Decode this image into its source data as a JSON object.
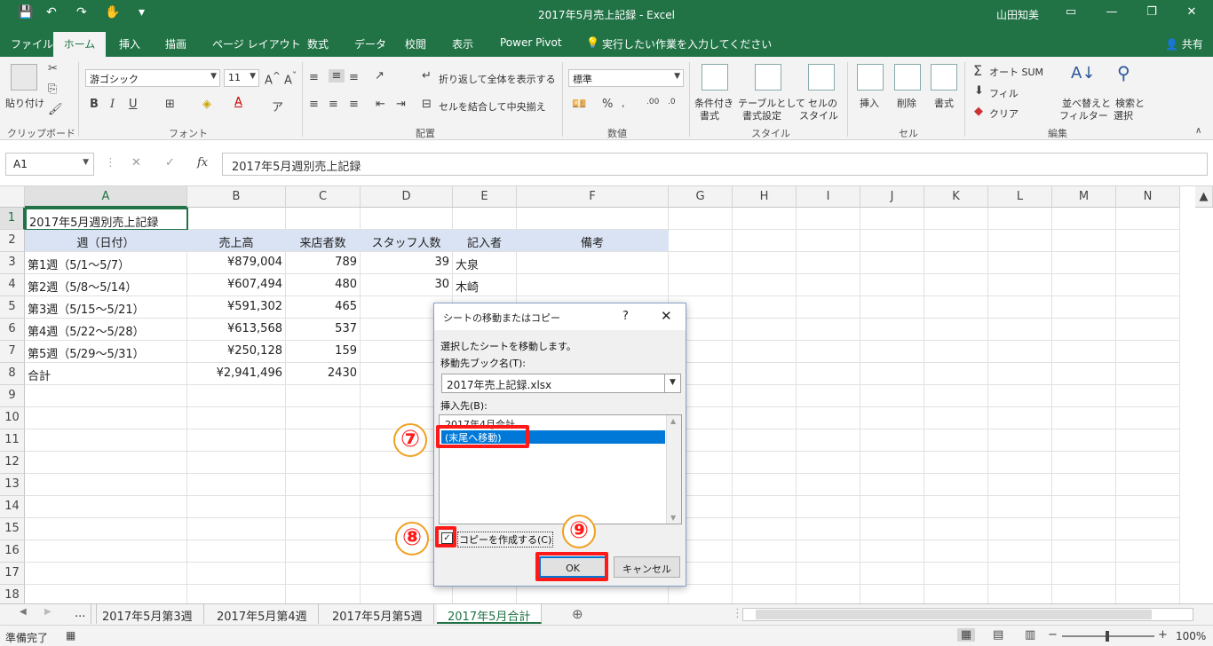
{
  "window": {
    "title": "2017年5月売上記録  -  Excel",
    "user": "山田知美",
    "min_btn": "—",
    "restore_btn": "❐",
    "close_btn": "✕"
  },
  "tabs": [
    "ファイル",
    "ホーム",
    "挿入",
    "描画",
    "ページ レイアウト",
    "数式",
    "データ",
    "校閲",
    "表示",
    "Power Pivot"
  ],
  "tell_me": "実行したい作業を入力してください",
  "share": "共有",
  "ribbon": {
    "clipboard": {
      "paste": "貼り付け",
      "label": "クリップボード"
    },
    "font": {
      "name": "游ゴシック",
      "size": "11",
      "bold": "B",
      "italic": "I",
      "underline": "U",
      "label": "フォント"
    },
    "alignment": {
      "wrap": "折り返して全体を表示する",
      "merge": "セルを結合して中央揃え",
      "label": "配置"
    },
    "number": {
      "format": "標準",
      "label": "数値"
    },
    "styles": {
      "cond1": "条件付き",
      "cond2": "書式",
      "table1": "テーブルとして",
      "table2": "書式設定",
      "cell1": "セルの",
      "cell2": "スタイル",
      "label": "スタイル"
    },
    "cells": {
      "insert": "挿入",
      "delete": "削除",
      "format": "書式",
      "label": "セル"
    },
    "editing": {
      "autosum": "オート SUM",
      "fill": "フィル",
      "clear": "クリア",
      "sort1": "並べ替えと",
      "sort2": "フィルター",
      "find1": "検索と",
      "find2": "選択",
      "label": "編集"
    }
  },
  "formula_bar": {
    "name_box": "A1",
    "formula": "2017年5月週別売上記録",
    "fx": "fx"
  },
  "columns": [
    "A",
    "B",
    "C",
    "D",
    "E",
    "F",
    "G",
    "H",
    "I",
    "J",
    "K",
    "L",
    "M",
    "N"
  ],
  "rows": [
    "1",
    "2",
    "3",
    "4",
    "5",
    "6",
    "7",
    "8",
    "9",
    "10",
    "11",
    "12",
    "13",
    "14",
    "15",
    "16",
    "17",
    "18"
  ],
  "sheet": {
    "title": "2017年5月週別売上記録",
    "headers": [
      "週（日付）",
      "売上高",
      "来店者数",
      "スタッフ人数",
      "記入者",
      "備考"
    ],
    "data": [
      [
        "第1週（5/1〜5/7）",
        "¥879,004",
        "789",
        "39",
        "大泉"
      ],
      [
        "第2週（5/8〜5/14）",
        "¥607,494",
        "480",
        "30",
        "木崎"
      ],
      [
        "第3週（5/15〜5/21）",
        "¥591,302",
        "465",
        "",
        ""
      ],
      [
        "第4週（5/22〜5/28）",
        "¥613,568",
        "537",
        "",
        ""
      ],
      [
        "第5週（5/29〜5/31）",
        "¥250,128",
        "159",
        "",
        ""
      ],
      [
        "合計",
        "¥2,941,496",
        "2430",
        "",
        ""
      ]
    ]
  },
  "sheet_tabs": {
    "ellipsis": "...",
    "tabs": [
      "2017年5月第3週",
      "2017年5月第4週",
      "2017年5月第5週",
      "2017年5月合計"
    ],
    "add": "⊕"
  },
  "status": {
    "ready": "準備完了",
    "zoom": "100%"
  },
  "dialog": {
    "title": "シートの移動またはコピー",
    "help": "?",
    "close": "✕",
    "instruction": "選択したシートを移動します。",
    "book_label": "移動先ブック名(T):",
    "book_value": "2017年売上記録.xlsx",
    "insert_label": "挿入先(B):",
    "list": [
      "2017年4月合計",
      "(末尾へ移動)"
    ],
    "copy_label": "コピーを作成する(C)",
    "ok": "OK",
    "cancel": "キャンセル"
  },
  "annotations": [
    "⑦",
    "⑧",
    "⑨"
  ],
  "colors": {
    "excel_green": "#217346",
    "highlight_red": "#ff1a1a",
    "selection_blue": "#0078d7",
    "header_fill": "#dae3f3"
  }
}
